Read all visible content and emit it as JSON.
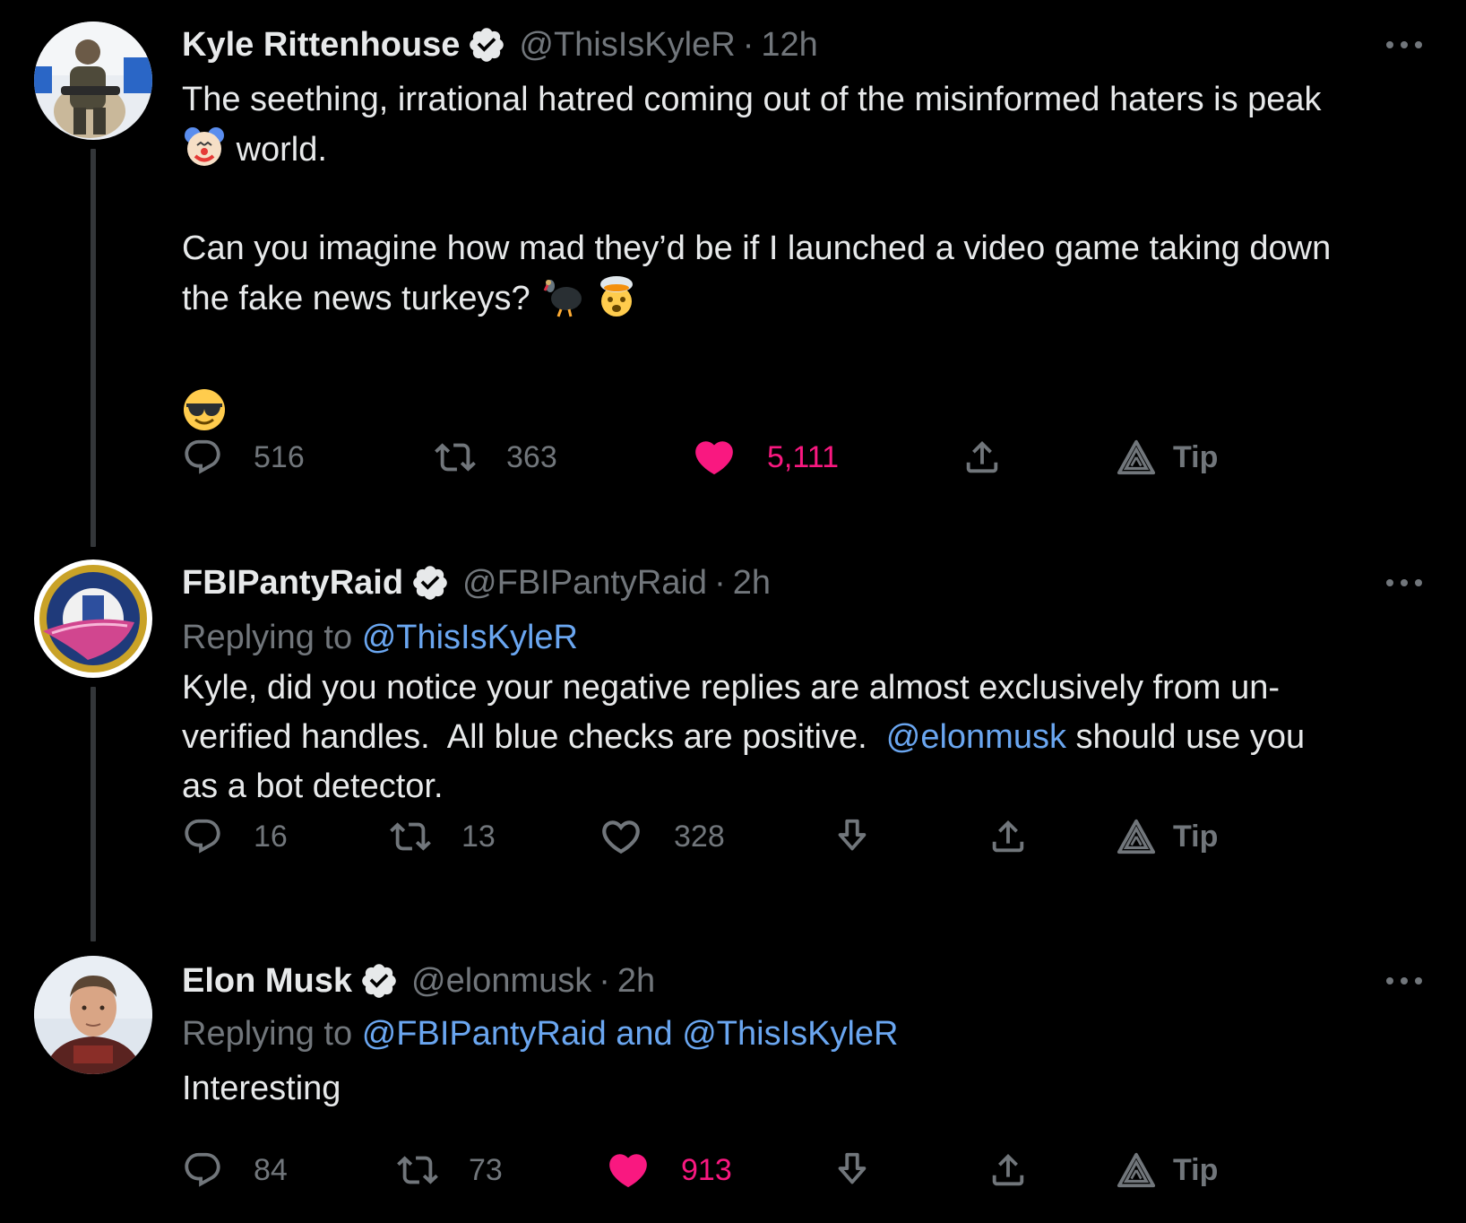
{
  "colors": {
    "background": "#000000",
    "text": "#e7e9ea",
    "muted": "#71767b",
    "link": "#6aa6f0",
    "like": "#f91880",
    "verified": "#e7e9ea",
    "thread_line": "#333639"
  },
  "tweets": [
    {
      "name": "Kyle Rittenhouse",
      "handle": "@ThisIsKyleR",
      "dot": "·",
      "time": "12h",
      "verified": true,
      "lines": [
        "The seething, irrational hatred coming out of the misinformed haters is peak",
        "world.",
        "Can you imagine how mad they’d be if I launched a video game taking down",
        "the fake news turkeys?"
      ],
      "emojis": [
        "clown-face",
        "turkey",
        "exploding-head",
        "smiling-face-with-sunglasses"
      ],
      "stats": {
        "replies": "516",
        "retweets": "363",
        "likes": "5,111",
        "liked": true
      },
      "tip_label": "Tip"
    },
    {
      "name": "FBIPantyRaid",
      "handle": "@FBIPantyRaid",
      "dot": "·",
      "time": "2h",
      "verified": true,
      "replying_prefix": "Replying to",
      "replying_to": "@ThisIsKyleR",
      "lines": [
        "Kyle, did you notice your negative replies are almost exclusively from un-",
        "verified handles.  All blue checks are positive.",
        "@elonmusk",
        "should use you",
        "as a bot detector."
      ],
      "stats": {
        "replies": "16",
        "retweets": "13",
        "likes": "328",
        "liked": false
      },
      "tip_label": "Tip"
    },
    {
      "name": "Elon Musk",
      "handle": "@elonmusk",
      "dot": "·",
      "time": "2h",
      "verified": true,
      "replying_prefix": "Replying to",
      "replying_to": "@FBIPantyRaid and @ThisIsKyleR",
      "lines": [
        "Interesting"
      ],
      "stats": {
        "replies": "84",
        "retweets": "73",
        "likes": "913",
        "liked": true
      },
      "tip_label": "Tip"
    }
  ]
}
